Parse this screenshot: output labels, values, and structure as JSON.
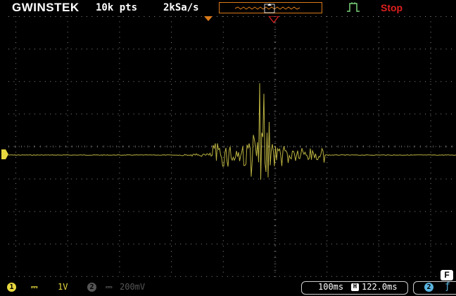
{
  "header": {
    "brand": "GWINSTEK",
    "record_length": "10k pts",
    "sample_rate": "2kSa/s",
    "run_state": "Stop"
  },
  "channel1": {
    "number": "1",
    "coupling_icon": "dc-coupling-icon",
    "coupling": "⎓",
    "scale": "1V",
    "color": "#e8d840"
  },
  "channel2": {
    "number": "2",
    "coupling_icon": "dc-coupling-icon",
    "coupling": "⎓",
    "scale": "200mV",
    "color": "#555555"
  },
  "timebase": {
    "scale": "100ms",
    "h_icon": "H",
    "position": "122.0ms"
  },
  "trigger": {
    "source": "2",
    "slope_icon": "rising-edge-icon",
    "slope": "ƒ",
    "color": "#5ab4e0"
  },
  "function_key": "F",
  "colors": {
    "trace": "#b8b040",
    "grid": "#8a8a8a",
    "accent_orange": "#d97a1a",
    "stop_red": "#e02020",
    "trigger_green": "#7ad07a"
  }
}
